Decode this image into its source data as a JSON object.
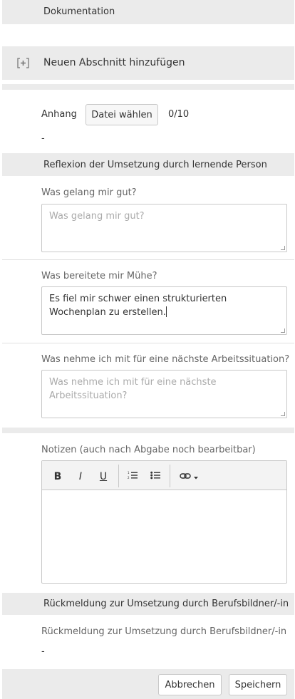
{
  "documentation": {
    "heading": "Dokumentation",
    "add_section_label": "Neuen Abschnitt hinzufügen"
  },
  "attachment": {
    "label": "Anhang",
    "choose_file_label": "Datei wählen",
    "count": "0/10",
    "empty_value": "-"
  },
  "reflection": {
    "heading": "Reflexion der Umsetzung durch lernende Person",
    "q1": {
      "label": "Was gelang mir gut?",
      "placeholder": "Was gelang mir gut?",
      "value": ""
    },
    "q2": {
      "label": "Was bereitete mir Mühe?",
      "placeholder": "",
      "value": "Es fiel mir schwer einen strukturierten Wochenplan zu erstellen."
    },
    "q3": {
      "label": "Was nehme ich mit für eine nächste Arbeitssituation?",
      "placeholder": "Was nehme ich mit für eine nächste Arbeitssituation?",
      "value": ""
    }
  },
  "notes": {
    "label": "Notizen (auch nach Abgabe noch bearbeitbar)",
    "toolbar": {
      "bold": "B",
      "italic": "I",
      "underline": "U"
    }
  },
  "feedback": {
    "heading": "Rückmeldung zur Umsetzung durch Berufsbildner/-in",
    "label": "Rückmeldung zur Umsetzung durch Berufsbildner/-in",
    "value": "-"
  },
  "footer": {
    "cancel_label": "Abbrechen",
    "save_label": "Speichern"
  }
}
